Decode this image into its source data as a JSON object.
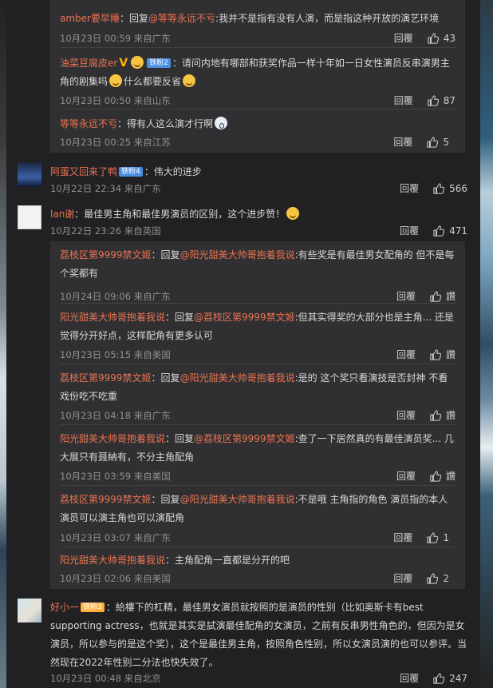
{
  "replies1": [
    {
      "name": "amber要早睡",
      "sep": "：",
      "reply_label": "回复",
      "reply_to": "@等等永远不亏",
      "text": ":我并不是指有没有人演，而是指这种开放的演艺环境",
      "time": "10月23日 00:59 来自广东",
      "reply": "回覆",
      "likes": "43"
    },
    {
      "name": "油菜豆腐皮er",
      "badge": "铁粉2",
      "text": "：请问内地有哪部和获奖作品一样十年如一日女性演员反串演男主角的剧集吗",
      "text2": "什么都要反省",
      "time": "10月23日 00:50 来自山东",
      "reply": "回覆",
      "likes": "87"
    },
    {
      "name": "等等永远不亏",
      "text": "：得有人这么演才行啊",
      "time": "10月23日 00:25 来自江苏",
      "reply": "回覆",
      "likes": "5"
    }
  ],
  "comments": [
    {
      "name": "阿蛋又回来了鸭",
      "badge": "铁粉4",
      "text": "：伟大的进步",
      "time": "10月22日 22:34 来自广东",
      "reply": "回覆",
      "likes": "566"
    },
    {
      "name": "lan谢",
      "text": "：最佳男主角和最佳男演员的区别，这个进步赞！",
      "time": "10月22日 23:26 来自英国",
      "reply": "回覆",
      "likes": "471"
    }
  ],
  "replies2": [
    {
      "name": "荔枝区第9999禁文姬",
      "reply_label": "：回复",
      "reply_to": "@阳光甜美大帅哥抱着我说",
      "text": ":有些奖是有最佳男女配角的 但不是每个奖都有",
      "time": "10月24日 09:06 来自广东",
      "reply": "回覆",
      "likes": "讚"
    },
    {
      "name": "阳光甜美大帅哥抱着我说",
      "reply_label": "：回复",
      "reply_to": "@荔枝区第9999禁文姬",
      "text": ":但其实得奖的大部分也是主角... 还是觉得分开好点，这样配角有更多认可",
      "time": "10月23日 05:15 来自美国",
      "reply": "回覆",
      "likes": "讚"
    },
    {
      "name": "荔枝区第9999禁文姬",
      "reply_label": "：回复",
      "reply_to": "@阳光甜美大帅哥抱着我说",
      "text": ":是的 这个奖只看演技是否封神 不看戏份吃不吃重",
      "time": "10月23日 04:18 来自广东",
      "reply": "回覆",
      "likes": "讚"
    },
    {
      "name": "阳光甜美大帅哥抱着我说",
      "reply_label": "：回复",
      "reply_to": "@荔枝区第9999禁文姬",
      "text": ":查了一下居然真的有最佳演员奖... 几大展只有聂納有，不分主角配角",
      "time": "10月23日 03:59 来自美国",
      "reply": "回覆",
      "likes": "讚"
    },
    {
      "name": "荔枝区第9999禁文姬",
      "reply_label": "：回复",
      "reply_to": "@阳光甜美大帅哥抱着我说",
      "text": ":不是哦 主角指的角色 演员指的本人 演员可以演主角也可以演配角",
      "time": "10月23日 03:07 来自广东",
      "reply": "回覆",
      "likes": "1"
    },
    {
      "name": "阳光甜美大帅哥抱着我说",
      "text": "：主角配角一直都是分开的吧",
      "time": "10月23日 02:06 来自美国",
      "reply": "回覆",
      "likes": "2"
    }
  ],
  "comment3": {
    "name": "好小一",
    "badge": "铁粉3",
    "text": "：給樓下的杠精，最佳男女演员就按照的是演员的性别（比如奥斯卡有best supporting actress，也就是其实是試演最佳配角的女演员，之前有反串男性角色的，但因为是女演员，所以参与的是这个奖），这个是最佳男主角，按照角色性别，所以女演员演的也可以参评。当然现在2022年性别二分法也快失效了。",
    "time": "10月23日 00:48 来自北京",
    "reply": "回覆",
    "likes": "247"
  }
}
